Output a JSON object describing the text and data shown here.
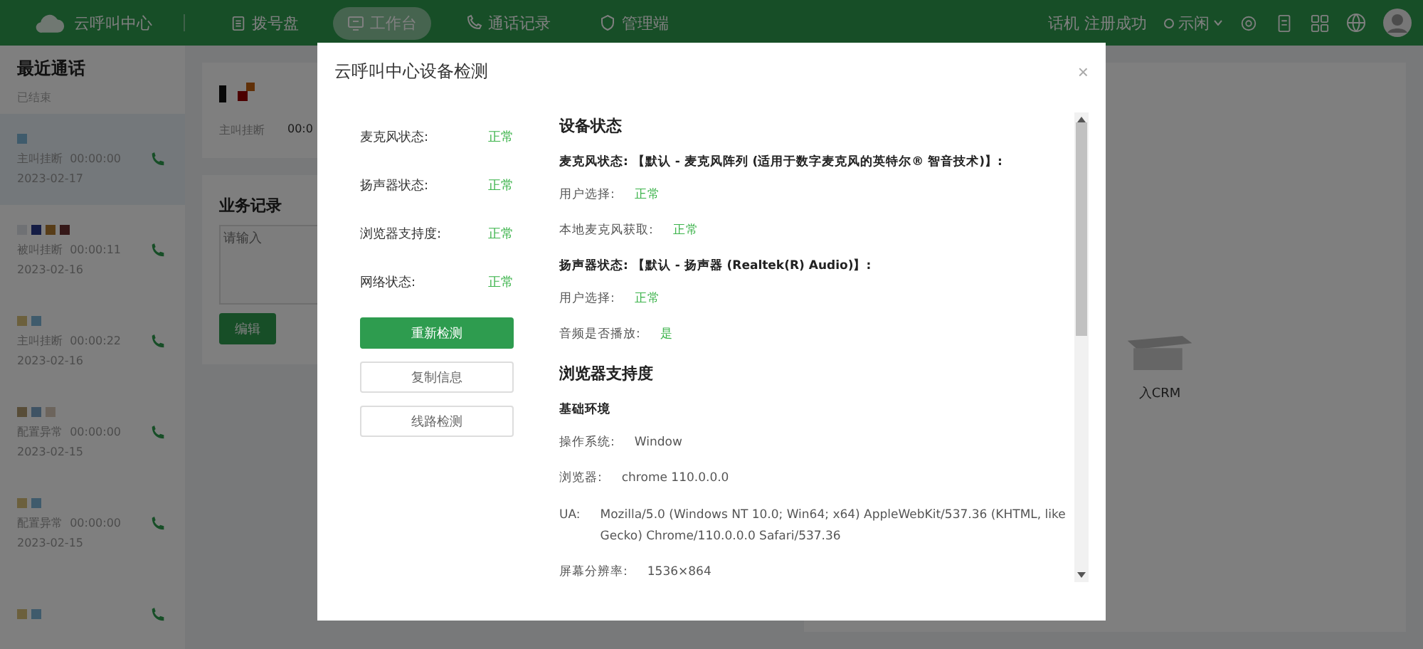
{
  "header": {
    "app_name": "云呼叫中心",
    "nav": [
      {
        "label": "拨号盘",
        "selected": false
      },
      {
        "label": "工作台",
        "selected": true
      },
      {
        "label": "通话记录",
        "selected": false
      },
      {
        "label": "管理端",
        "selected": false
      }
    ],
    "phone_status": "话机 注册成功",
    "agent_status": "示闲"
  },
  "sidebar": {
    "title": "最近通话",
    "subtitle": "已结束",
    "calls": [
      {
        "result": "主叫挂断",
        "duration": "00:00:00",
        "date": "2023-02-17",
        "selected": true
      },
      {
        "result": "被叫挂断",
        "duration": "00:00:11",
        "date": "2023-02-16",
        "selected": false
      },
      {
        "result": "主叫挂断",
        "duration": "00:00:22",
        "date": "2023-02-16",
        "selected": false
      },
      {
        "result": "配置异常",
        "duration": "00:00:00",
        "date": "2023-02-15",
        "selected": false
      },
      {
        "result": "配置异常",
        "duration": "00:00:00",
        "date": "2023-02-15",
        "selected": false
      }
    ]
  },
  "detail": {
    "result": "主叫挂断",
    "duration": "00:0",
    "record_title": "业务记录",
    "record_placeholder": "请输入",
    "edit_button": "编辑"
  },
  "crm": {
    "label": "入CRM"
  },
  "dialog": {
    "title": "云呼叫中心设备检测",
    "close": "×",
    "checks": [
      {
        "label": "麦克风状态:",
        "value": "正常"
      },
      {
        "label": "扬声器状态:",
        "value": "正常"
      },
      {
        "label": "浏览器支持度:",
        "value": "正常"
      },
      {
        "label": "网络状态:",
        "value": "正常"
      }
    ],
    "buttons": [
      {
        "label": "重新检测",
        "primary": true
      },
      {
        "label": "复制信息",
        "primary": false
      },
      {
        "label": "线路检测",
        "primary": false
      }
    ],
    "details": [
      {
        "kind": "heading",
        "text": "设备状态"
      },
      {
        "kind": "bold",
        "text": "麦克风状态: 【默认 - 麦克风阵列 (适用于数字麦克风的英特尔® 智音技术)】:"
      },
      {
        "kind": "status",
        "label": "用户选择:",
        "value": "正常"
      },
      {
        "kind": "status",
        "label": "本地麦克风获取:",
        "value": "正常"
      },
      {
        "kind": "bold",
        "text": "扬声器状态: 【默认 - 扬声器 (Realtek(R) Audio)】:"
      },
      {
        "kind": "status",
        "label": "用户选择:",
        "value": "正常"
      },
      {
        "kind": "status",
        "label": "音频是否播放:",
        "value": "是"
      },
      {
        "kind": "heading",
        "text": "浏览器支持度"
      },
      {
        "kind": "bold",
        "text": "基础环境"
      },
      {
        "kind": "info",
        "label": "操作系统:",
        "value": "Window"
      },
      {
        "kind": "info",
        "label": "浏览器:",
        "value": "chrome 110.0.0.0"
      },
      {
        "kind": "info",
        "label": "UA:",
        "value": "Mozilla/5.0 (Windows NT 10.0; Win64; x64) AppleWebKit/537.36 (KHTML, like Gecko) Chrome/110.0.0.0 Safari/537.36"
      },
      {
        "kind": "info",
        "label": "屏幕分辨率:",
        "value": "1536×864"
      }
    ]
  }
}
